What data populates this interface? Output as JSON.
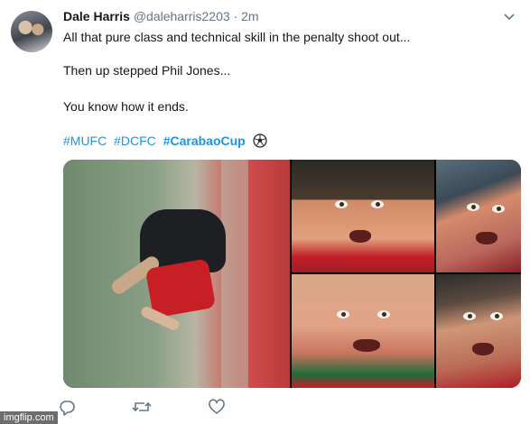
{
  "tweet": {
    "author": {
      "name": "Dale Harris",
      "handle": "@daleharris2203",
      "separator": "·",
      "time": "2m"
    },
    "text": {
      "line1": "All that pure class and technical skill in the penalty shoot out...",
      "line2": "Then up stepped Phil Jones...",
      "line3": "You know how it ends."
    },
    "hashtags": [
      "#MUFC",
      "#DCFC",
      "#CarabaoCup"
    ],
    "emoji_icon": "soccer-ball-icon",
    "menu_icon": "chevron-down-icon",
    "media": {
      "photos": [
        "main-photo",
        "face-photo-1",
        "face-photo-2",
        "face-photo-3",
        "face-photo-4"
      ]
    },
    "actions": {
      "reply_icon": "reply-icon",
      "retweet_icon": "retweet-icon",
      "like_icon": "heart-icon"
    }
  },
  "watermark": "imgflip.com",
  "colors": {
    "link": "#1b95e0",
    "text": "#14171a",
    "secondary": "#657786"
  }
}
